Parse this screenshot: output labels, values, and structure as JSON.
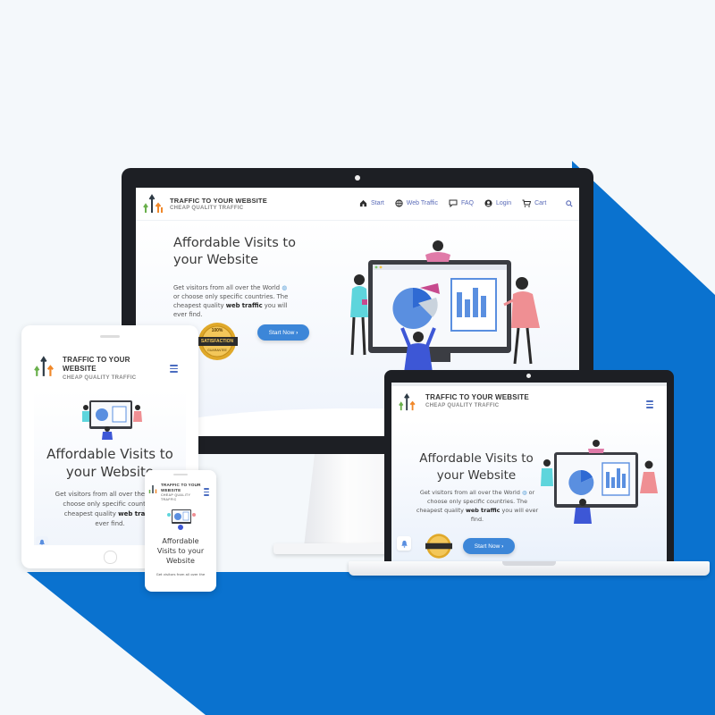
{
  "brand": {
    "title": "TRAFFIC TO YOUR WEBSITE",
    "title_line1": "TRAFFIC TO YOUR",
    "title_line2": "WEBSITE",
    "subtitle": "CHEAP QUALITY TRAFFIC",
    "subtitle_line1": "CHEAP QUALITY",
    "subtitle_line2": "TRAFFIC"
  },
  "nav": {
    "start": "Start",
    "web_traffic": "Web Traffic",
    "faq": "FAQ",
    "login": "Login",
    "cart": "Cart"
  },
  "hero": {
    "title": "Affordable Visits to your Website",
    "title_line1": "Affordable Visits to",
    "title_line2": "your Website",
    "text_line1": "Get visitors from all over the World",
    "text_line2": "or choose only specific countries. The",
    "text_line3": "cheapest quality",
    "text_bold": "web traffic",
    "text_line3_end": "you will",
    "text_line4": "ever find.",
    "cta": "Start Now",
    "cta_arrow": "›"
  },
  "laptop_hero": {
    "text_line1": "Get visitors from all over the World",
    "text_line1_end": "or",
    "text_line2": "choose only specific countries. The",
    "text_line3": "cheapest quality",
    "text_line3_end": "you will ever",
    "text_line4": "find."
  },
  "tablet_hero": {
    "title_line1": "Affordable Visits to",
    "title_line2": "your Website",
    "text_line1": "Get visitors from all over the World",
    "text_line2": "choose only specific countries",
    "text_line3": "cheapest quality",
    "text_line4": "ever find."
  },
  "phone_hero": {
    "title_line1": "Affordable",
    "title_line2": "Visits to your",
    "title_line3": "Website",
    "text_line1": "Get visitors from all over the"
  },
  "badge": {
    "top": "100%",
    "band": "SATISFACTION",
    "bottom": "GUARANTEE"
  },
  "colors": {
    "accent": "#3c86d8",
    "diagonal_blue": "#0a72cf",
    "page_bg": "#f4f8fb",
    "nav_text": "#5a6bb8",
    "badge_gold": "#e0a92a"
  }
}
